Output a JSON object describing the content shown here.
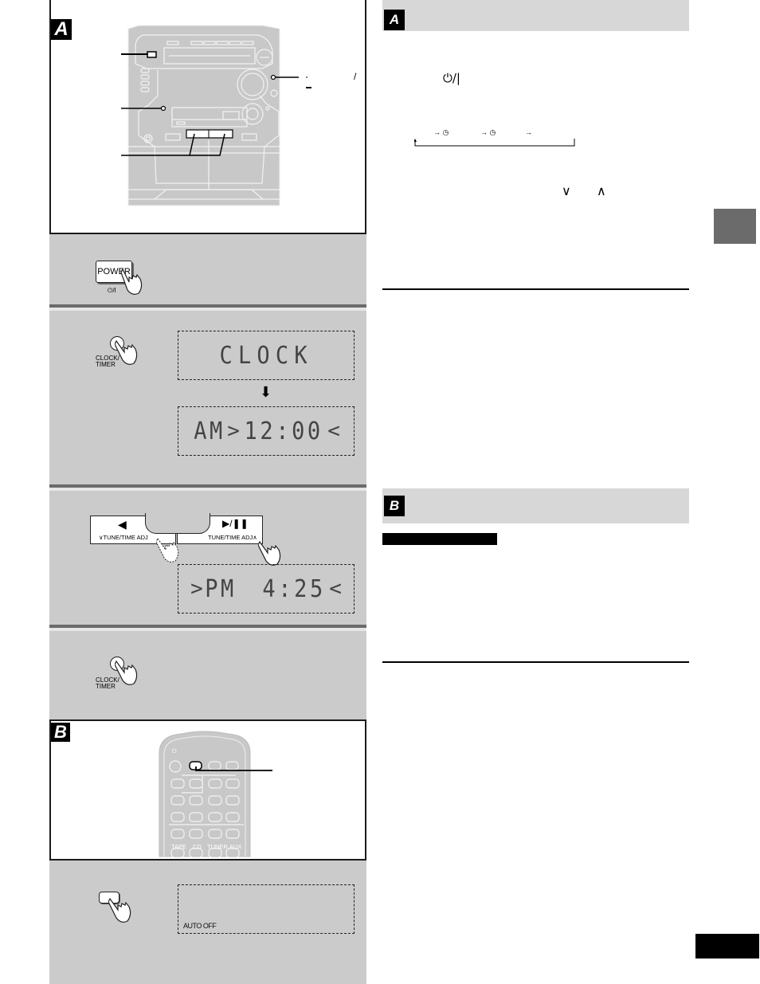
{
  "left": {
    "section_a_badge": "A",
    "section_b_badge": "B",
    "stereo": {
      "callout_right_mark": "/"
    },
    "step1": {
      "button_label": "POWER",
      "button_symbol": "⏻/I"
    },
    "step2": {
      "button_label_line1": "CLOCK/",
      "button_label_line2": "TIMER",
      "display_1": "CLOCK",
      "display_2_prefix": "AM",
      "display_2_time": "12:00",
      "arrow": "⬇"
    },
    "step3": {
      "left_button_symbol": "◀",
      "left_button_label": "∨TUNE/TIME ADJ",
      "right_button_symbol": "▶/❚❚",
      "right_button_label": "TUNE/TIME ADJ∧",
      "display_prefix": "PM",
      "display_time": "4:25"
    },
    "step4": {
      "button_label_line1": "CLOCK/",
      "button_label_line2": "TIMER"
    },
    "remote": {
      "power_symbol": "⏻",
      "source_labels": [
        "TAPE",
        "CD",
        "TUNER",
        "AUX"
      ]
    },
    "step5": {
      "display_indicator": "AUTO OFF"
    }
  },
  "right": {
    "section_a_badge": "A",
    "section_b_badge": "B",
    "power_symbol": "⏻/|",
    "cycle_arrows": [
      "→ ◷",
      "→ ◷",
      "→"
    ],
    "adjust_symbols": [
      "∨",
      "∧"
    ]
  }
}
